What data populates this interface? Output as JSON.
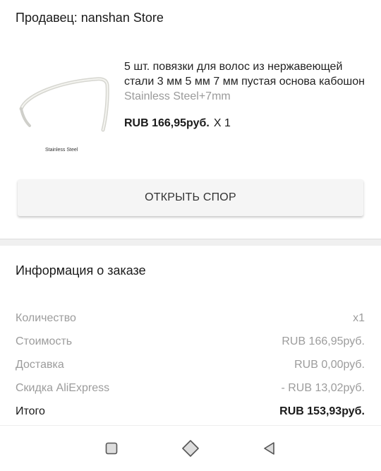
{
  "seller": {
    "label": "Продавец: nanshan Store"
  },
  "product": {
    "title": "5 шт. повязки для волос из нержавеющей стали 3 мм 5 мм 7 мм пустая основа кабошон",
    "variant": "Stainless Steel+7mm",
    "price": "RUB 166,95руб.",
    "quantity": "X 1",
    "image_caption": "Stainless Steel"
  },
  "actions": {
    "open_dispute": "ОТКРЫТЬ СПОР"
  },
  "order_info": {
    "title": "Информация о заказе",
    "rows": [
      {
        "label": "Количество",
        "value": "x1"
      },
      {
        "label": "Стоимость",
        "value": "RUB 166,95руб."
      },
      {
        "label": "Доставка",
        "value": "RUB 0,00руб."
      },
      {
        "label": "Скидка AliExpress",
        "value": "- RUB 13,02руб."
      }
    ],
    "total": {
      "label": "Итого",
      "value": "RUB 153,93руб."
    }
  },
  "navbar": {
    "icons": [
      "recents-square-icon",
      "home-diamond-icon",
      "back-triangle-icon"
    ]
  },
  "colors": {
    "muted_text": "#9c9c9c",
    "button_bg": "#f5f5f5",
    "divider": "#f0f0f0"
  }
}
